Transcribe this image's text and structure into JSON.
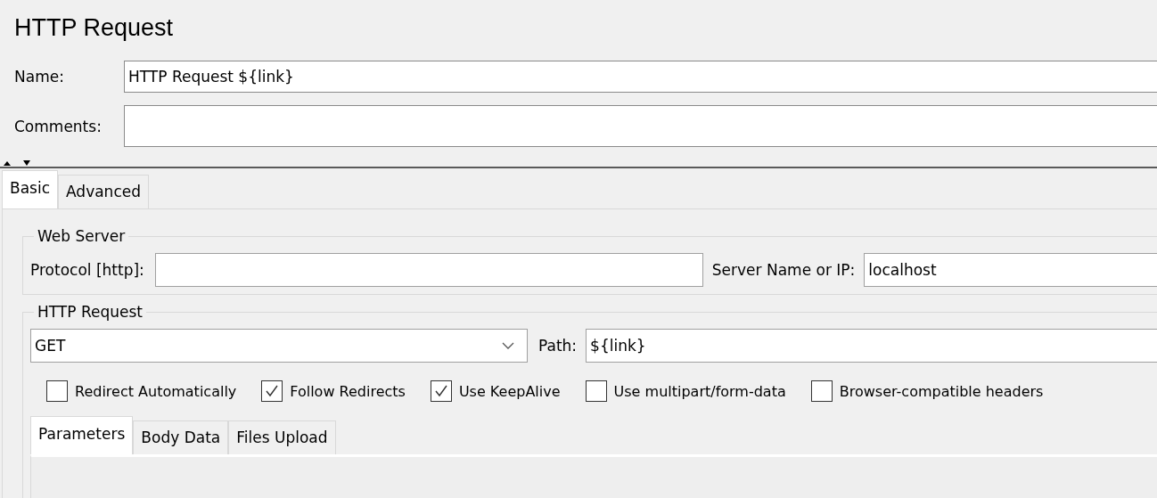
{
  "title": "HTTP Request",
  "name_field": {
    "label": "Name:",
    "value": "HTTP Request ${link}"
  },
  "comments_field": {
    "label": "Comments:"
  },
  "tabs": [
    {
      "label": "Basic",
      "selected": true
    },
    {
      "label": "Advanced",
      "selected": false
    }
  ],
  "web_server": {
    "legend": "Web Server",
    "protocol": {
      "label": "Protocol [http]:"
    },
    "server": {
      "label": "Server Name or IP:",
      "value": "localhost"
    }
  },
  "http_request": {
    "legend": "HTTP Request",
    "method": {
      "value": "GET"
    },
    "path": {
      "label": "Path:",
      "value": "${link}"
    },
    "options": [
      {
        "label": "Redirect Automatically",
        "checked": false
      },
      {
        "label": "Follow Redirects",
        "checked": true
      },
      {
        "label": "Use KeepAlive",
        "checked": true
      },
      {
        "label": "Use multipart/form-data",
        "checked": false
      },
      {
        "label": "Browser-compatible headers",
        "checked": false
      }
    ],
    "tabs": [
      {
        "label": "Parameters",
        "selected": true
      },
      {
        "label": "Body Data",
        "selected": false
      },
      {
        "label": "Files Upload",
        "selected": false
      }
    ]
  }
}
